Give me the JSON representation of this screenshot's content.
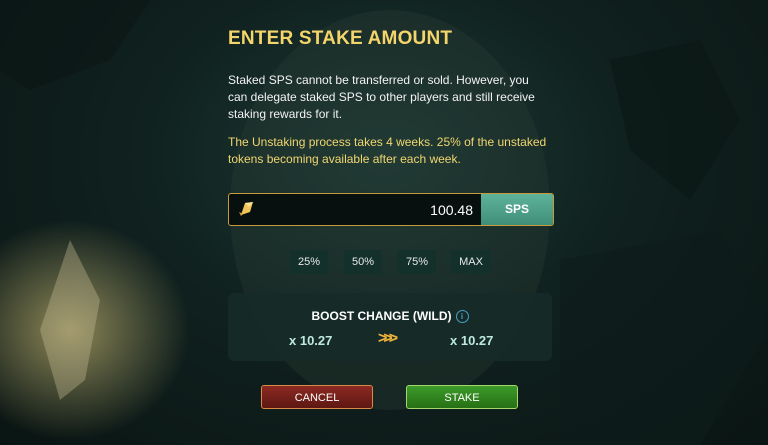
{
  "modal": {
    "title": "ENTER STAKE AMOUNT",
    "description": "Staked SPS cannot be transferred or sold. However, you can delegate staked SPS to other players and still receive staking rewards for it.",
    "note": "The Unstaking process takes 4 weeks. 25% of the unstaked tokens becoming available after each week.",
    "amount_value": "100.48",
    "unit": "SPS",
    "token_icon": "sps-token-icon",
    "percent_buttons": [
      "25%",
      "50%",
      "75%",
      "MAX"
    ],
    "boost": {
      "title": "BOOST CHANGE (WILD)",
      "info_icon": "info-icon",
      "current": "x 10.27",
      "arrows": ">>>",
      "new": "x 10.27"
    },
    "cancel_label": "CANCEL",
    "stake_label": "STAKE"
  },
  "colors": {
    "title": "#f4d56b",
    "note": "#f0d670",
    "unit_bg": "#4fa58c",
    "cancel_bg": "#7a231c",
    "stake_bg": "#338a22"
  }
}
